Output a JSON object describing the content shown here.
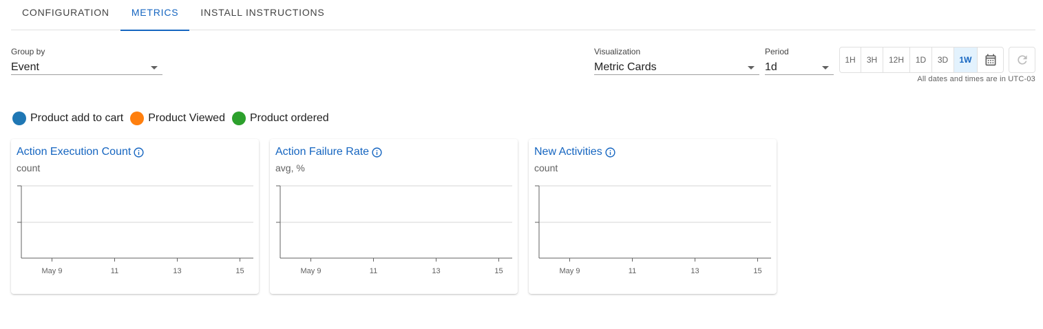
{
  "tabs": [
    {
      "label": "CONFIGURATION",
      "active": false
    },
    {
      "label": "METRICS",
      "active": true
    },
    {
      "label": "INSTALL INSTRUCTIONS",
      "active": false
    }
  ],
  "group_by": {
    "label": "Group by",
    "value": "Event"
  },
  "visualization": {
    "label": "Visualization",
    "value": "Metric Cards"
  },
  "period": {
    "label": "Period",
    "value": "1d"
  },
  "ranges": [
    "1H",
    "3H",
    "12H",
    "1D",
    "3D",
    "1W"
  ],
  "active_range": "1W",
  "icons": {
    "calendar": "calendar-icon",
    "refresh": "refresh-icon",
    "info": "info-icon",
    "dropdown": "chevron-down-icon"
  },
  "timezone_note": "All dates and times are in UTC-03",
  "legend": [
    {
      "label": "Product add to cart",
      "color": "#1f77b4"
    },
    {
      "label": "Product Viewed",
      "color": "#ff7f0e"
    },
    {
      "label": "Product ordered",
      "color": "#2ca02c"
    }
  ],
  "colors": {
    "accent": "#1565c0",
    "active_range_bg": "#e3f2fd"
  },
  "cards": [
    {
      "title": "Action Execution Count",
      "unit": "count"
    },
    {
      "title": "Action Failure Rate",
      "unit": "avg, %"
    },
    {
      "title": "New Activities",
      "unit": "count"
    }
  ],
  "chart_data": [
    {
      "type": "line",
      "title": "Action Execution Count",
      "ylabel": "count",
      "x_ticks": [
        "May 9",
        "11",
        "13",
        "15"
      ],
      "series": []
    },
    {
      "type": "line",
      "title": "Action Failure Rate",
      "ylabel": "avg, %",
      "x_ticks": [
        "May 9",
        "11",
        "13",
        "15"
      ],
      "series": []
    },
    {
      "type": "line",
      "title": "New Activities",
      "ylabel": "count",
      "x_ticks": [
        "May 9",
        "11",
        "13",
        "15"
      ],
      "series": []
    }
  ]
}
